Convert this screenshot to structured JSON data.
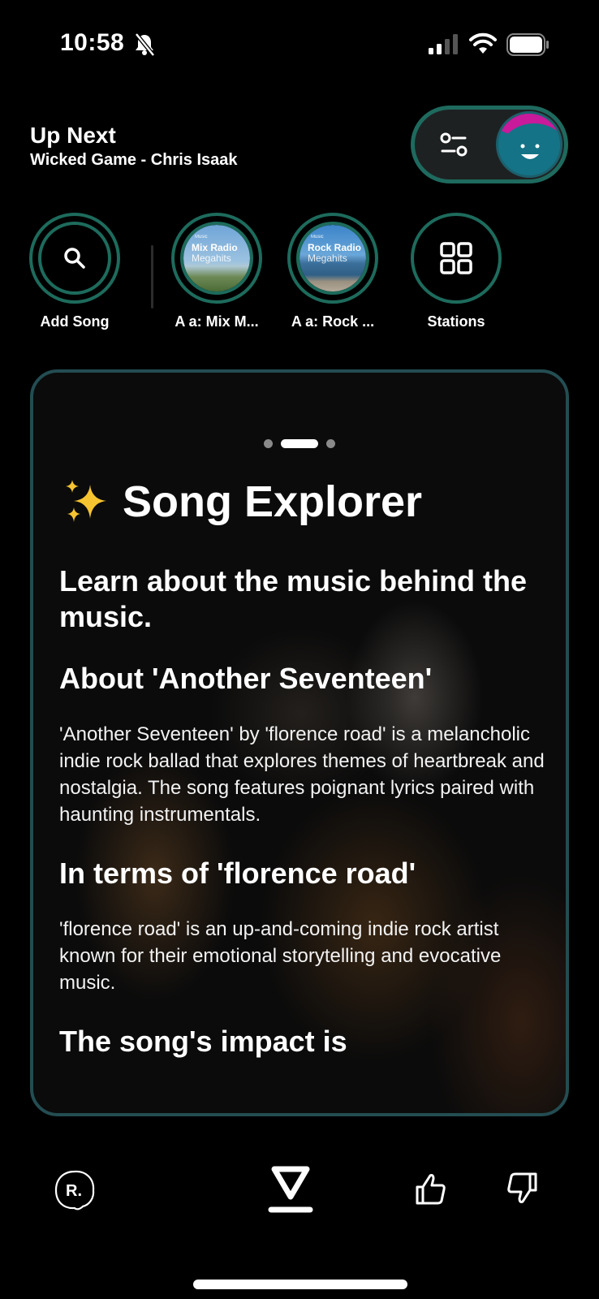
{
  "status_bar": {
    "time": "10:58",
    "icons": [
      "bell-slash-icon",
      "cellular-signal-icon",
      "wifi-icon",
      "battery-icon"
    ]
  },
  "up_next": {
    "title": "Up Next",
    "song": "Wicked Game - Chris Isaak"
  },
  "toggle": {
    "left_icon": "sliders-icon",
    "right_icon": "avatar-smiley",
    "colors": {
      "border": "#1e6a5e",
      "avatar": "#147386",
      "hair": "#c81a9a"
    }
  },
  "shortcuts": [
    {
      "label": "Add Song",
      "icon": "search-icon"
    },
    {
      "label": "A a: Mix M...",
      "art_brand": "Music",
      "art_title": "Mix Radio",
      "art_subtitle": "Megahits"
    },
    {
      "label": "A a: Rock ...",
      "art_brand": "Music",
      "art_title": "Rock Radio",
      "art_subtitle": "Megahits"
    },
    {
      "label": "Stations",
      "icon": "grid-icon"
    }
  ],
  "card": {
    "page_count": 3,
    "active_page": 2,
    "title": "Song Explorer",
    "title_icon": "sparkles-icon",
    "lead": "Learn about the music behind the music.",
    "sections": [
      {
        "heading": "About 'Another Seventeen'",
        "body": "'Another Seventeen' by 'florence road' is a melancholic indie rock ballad that explores themes of heartbreak and nostalgia. The song features poignant lyrics paired with haunting instrumentals."
      },
      {
        "heading": "In terms of 'florence road'",
        "body": "'florence road' is an up-and-coming indie rock artist known for their emotional storytelling and evocative music."
      },
      {
        "heading": "The song's impact is"
      }
    ],
    "colors": {
      "border": "#234d52"
    }
  },
  "bottom_bar": {
    "badge_letter": "R.",
    "actions": [
      "skip-icon",
      "thumbs-up-icon",
      "thumbs-down-icon"
    ]
  }
}
